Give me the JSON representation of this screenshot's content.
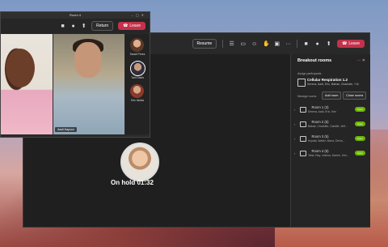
{
  "main_window": {
    "toolbar": {
      "resume_label": "Resume",
      "more_label": "···",
      "leave_label": "Leave"
    },
    "hold_text": "On hold 01:32"
  },
  "breakout_panel": {
    "title": "Breakout rooms",
    "assign_label": "Assign participants",
    "assigned_room": {
      "name": "Cellular Respiration 1.2",
      "participants": "Serena, Aadi, Eric, Babak, Charlotte, +1k"
    },
    "manage_label": "Manage rooms",
    "add_room_label": "Add room",
    "close_rooms_label": "Close rooms",
    "rooms": [
      {
        "name": "Room 1 (3)",
        "participants": "Serena, Aadi, Eric, Ken",
        "status": "Open"
      },
      {
        "name": "Room 2 (5)",
        "participants": "Babak, Charlotte, Camille, Jeff...",
        "status": "Open"
      },
      {
        "name": "Room 3 (5)",
        "participants": "Krystal, Walter, Mona, Devin...",
        "status": "Open"
      },
      {
        "name": "Room 4 (6)",
        "participants": "Taha, Ray, Joshua, Darren, Kris...",
        "status": "Open"
      }
    ]
  },
  "room_window": {
    "title": "Room 4",
    "return_label": "Return",
    "leave_label": "Leave",
    "video_name": "Aadi Kapoor",
    "roster": [
      {
        "name": "Sarah Perez"
      },
      {
        "name": "Tom Davis"
      },
      {
        "name": "Eric Ishida"
      }
    ]
  }
}
